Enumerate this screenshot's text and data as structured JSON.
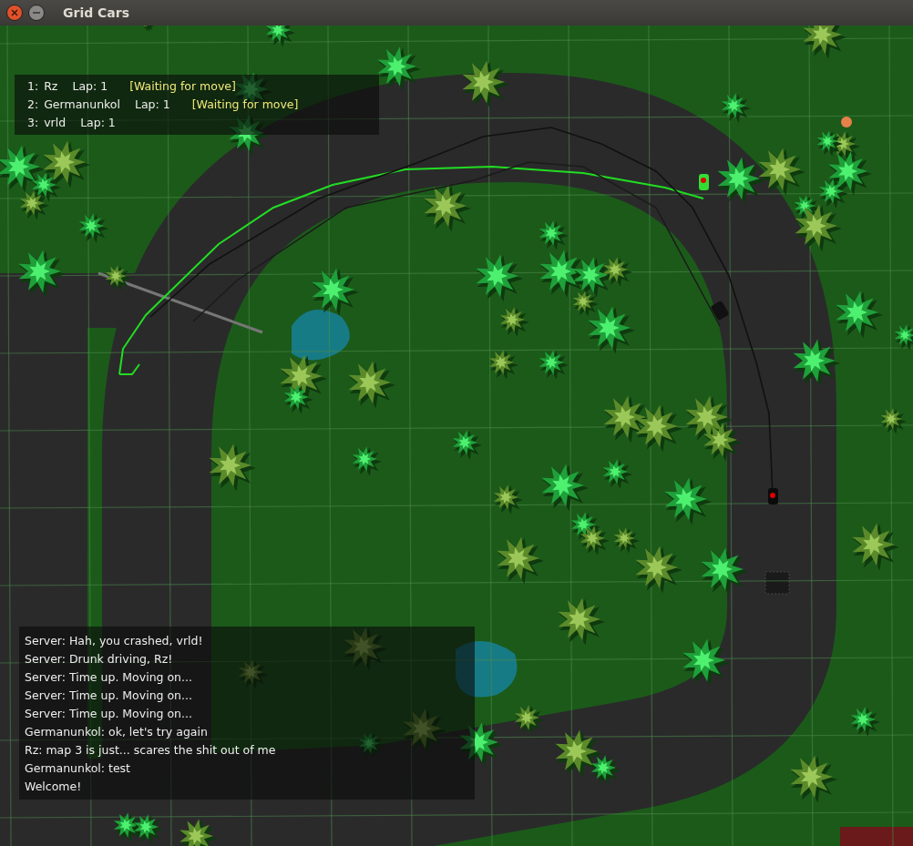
{
  "window": {
    "title": "Grid Cars"
  },
  "players": [
    {
      "rank": "1:",
      "name": "Rz",
      "lap": "Lap: 1",
      "status": "[Waiting for move]"
    },
    {
      "rank": "2:",
      "name": "Germanunkol",
      "lap": "Lap: 1",
      "status": "[Waiting for move]"
    },
    {
      "rank": "3:",
      "name": "vrld",
      "lap": "Lap: 1"
    }
  ],
  "chat": [
    "Server: Hah, you crashed, vrld!",
    "Server: Drunk driving, Rz!",
    "Server: Time up. Moving on...",
    "Server: Time up. Moving on...",
    "Server: Time up. Moving on...",
    "Germanunkol: ok, let's try again",
    "Rz: map 3 is just... scares the shit out of me",
    "Germanunkol: test",
    "Welcome!"
  ]
}
